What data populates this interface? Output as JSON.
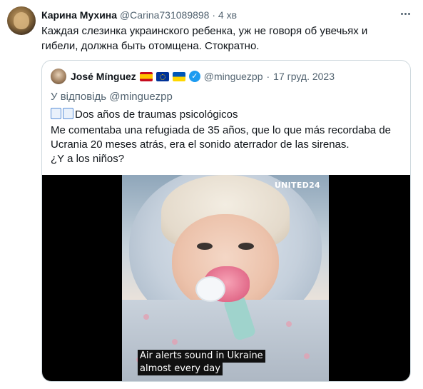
{
  "author": {
    "name": "Карина Мухина",
    "handle": "@Carina731089898",
    "separator": "·",
    "time": "4 хв"
  },
  "tweet_text": "Каждая слезинка украинского ребенка, уж не говоря об увечьях и гибели, должна быть отомщена. Стократно.",
  "quoted": {
    "name": "José Mínguez",
    "flags": [
      "spain-flag",
      "eu-flag",
      "ukraine-flag"
    ],
    "handle": "@minguezpp",
    "separator": "·",
    "date": "17 груд. 2023",
    "reply_to": "У відповідь @minguezpp",
    "text_lines": [
      "Dos años de traumas psicológicos",
      "Me comentaba una refugiada de 35 años, que lo que más recordaba de",
      "Ucrania 20 meses atrás, era el sonido aterrador de las sirenas.",
      "¿Y a los niños?"
    ],
    "video": {
      "watermark": "UNITED24",
      "caption_line1": "Air alerts sound in Ukraine",
      "caption_line2": "almost every day"
    }
  },
  "colors": {
    "text": "#0f1419",
    "muted": "#536471",
    "border": "#cfd9de",
    "verified": "#1d9bf0"
  }
}
